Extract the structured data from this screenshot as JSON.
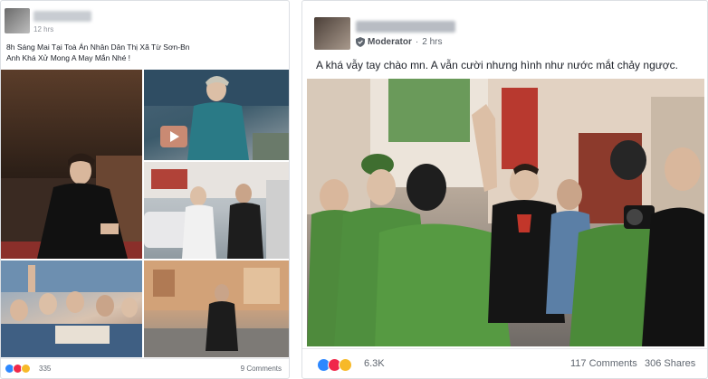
{
  "left_post": {
    "timestamp": "12 hrs",
    "body_line1": "8h Sáng Mai Tại Toà Án Nhân Dân Thị Xã Từ Sơn-Bn",
    "body_line2": "Anh Khá Xử Mong A May Mắn Nhé !",
    "reaction_count": "335",
    "comments": "9 Comments"
  },
  "right_post": {
    "role": "Moderator",
    "timestamp": "2 hrs",
    "body": "A khá vẫy tay chào mn. A vẫn cười nhưng hình như nước mắt chảy ngược.",
    "reaction_count": "6.3K",
    "comments": "117 Comments",
    "shares": "306 Shares"
  },
  "colors": {
    "like": "#2d88ff",
    "love": "#f0284a",
    "haha": "#f7b928",
    "text": "#1d2129",
    "meta": "#606770"
  }
}
